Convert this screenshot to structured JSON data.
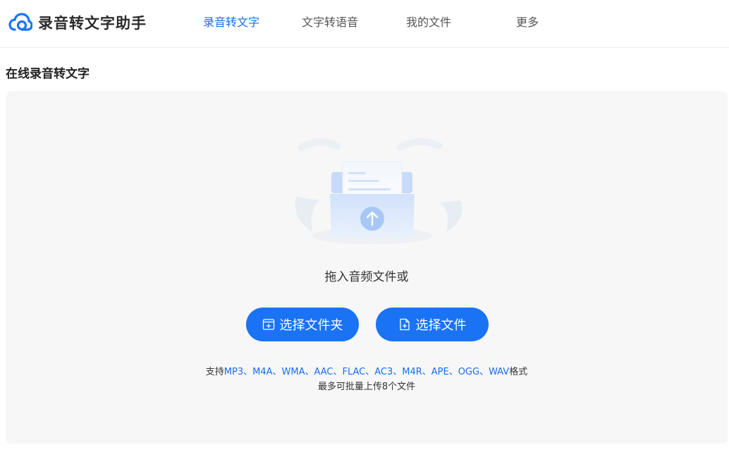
{
  "app": {
    "name": "录音转文字助手"
  },
  "nav": [
    {
      "label": "录音转文字",
      "active": true
    },
    {
      "label": "文字转语音",
      "active": false
    },
    {
      "label": "我的文件",
      "active": false
    },
    {
      "label": "更多",
      "active": false
    }
  ],
  "page": {
    "title": "在线录音转文字"
  },
  "upload": {
    "drop_text": "拖入音频文件或",
    "folder_button": "选择文件夹",
    "file_button": "选择文件",
    "formats_prefix": "支持",
    "formats": "MP3、M4A、WMA、AAC、FLAC、AC3、M4R、APE、OGG、WAV",
    "formats_suffix": "格式",
    "limit_text": "最多可批量上传8个文件"
  },
  "colors": {
    "accent": "#1a73f5",
    "link": "#1a6cf0",
    "panel": "#f7f7f7"
  },
  "icons": {
    "logo": "cloud-icon",
    "folder": "folder-plus-icon",
    "file": "file-plus-icon",
    "upload": "upload-arrow-icon"
  }
}
